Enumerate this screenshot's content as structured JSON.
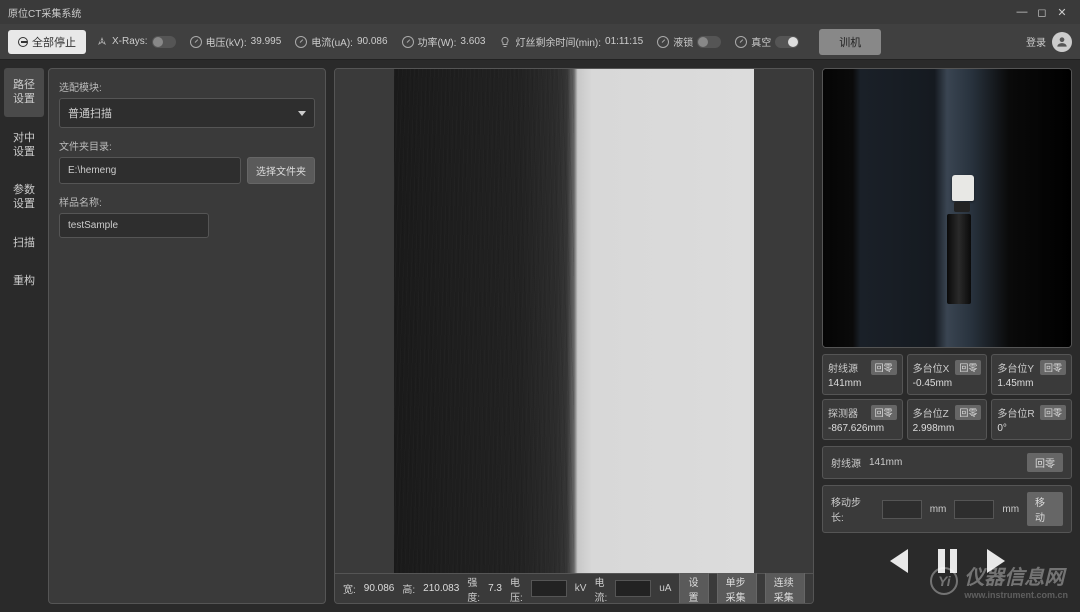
{
  "app": {
    "title": "原位CT采集系统"
  },
  "window": {
    "min": "—",
    "max": "◻",
    "close": "✕"
  },
  "toolbar": {
    "stop_all": "全部停止",
    "xrays_label": "X-Rays:",
    "voltage_label": "电压(kV):",
    "voltage_value": "39.995",
    "current_label": "电流(uA):",
    "current_value": "90.086",
    "power_label": "功率(W):",
    "power_value": "3.603",
    "filament_label": "灯丝剩余时间(min):",
    "filament_value": "01:11:15",
    "cooling_label": "液锁",
    "vacuum_label": "真空",
    "train": "训机",
    "login": "登录"
  },
  "tabs": {
    "path": "路径\n设置",
    "align": "对中\n设置",
    "param": "参数\n设置",
    "scan": "扫描",
    "recon": "重构"
  },
  "panel": {
    "module_label": "选配模块:",
    "module_value": "普通扫描",
    "folder_label": "文件夹目录:",
    "folder_value": "E:\\hemeng",
    "choose_folder": "选择文件夹",
    "sample_label": "样品名称:",
    "sample_value": "testSample"
  },
  "bottom": {
    "width_label": "宽:",
    "width_value": "90.086",
    "height_label": "高:",
    "height_value": "210.083",
    "intensity_label": "强度:",
    "intensity_value": "7.3",
    "voltage_label": "电压:",
    "voltage_unit": "kV",
    "current_label": "电流:",
    "current_unit": "uA",
    "settings": "设置",
    "single": "单步采集",
    "continuous": "连续采集"
  },
  "positions": {
    "zero": "回零",
    "source_label": "射线源",
    "source_value": "141mm",
    "detector_label": "探测器",
    "detector_value": "-867.626mm",
    "multiX_label": "多台位X",
    "multiX_value": "-0.45mm",
    "multiZ_label": "多台位Z",
    "multiZ_value": "2.998mm",
    "multiY_label": "多台位Y",
    "multiY_value": "1.45mm",
    "multiR_label": "多台位R",
    "multiR_value": "0°"
  },
  "move": {
    "row1_label": "射线源",
    "row1_value": "141mm",
    "step_label": "移动步长:",
    "unit": "mm",
    "move_btn": "移动"
  },
  "watermark": {
    "text": "仪器信息网",
    "sub": "www.instrument.com.cn",
    "icon": "Yi"
  }
}
